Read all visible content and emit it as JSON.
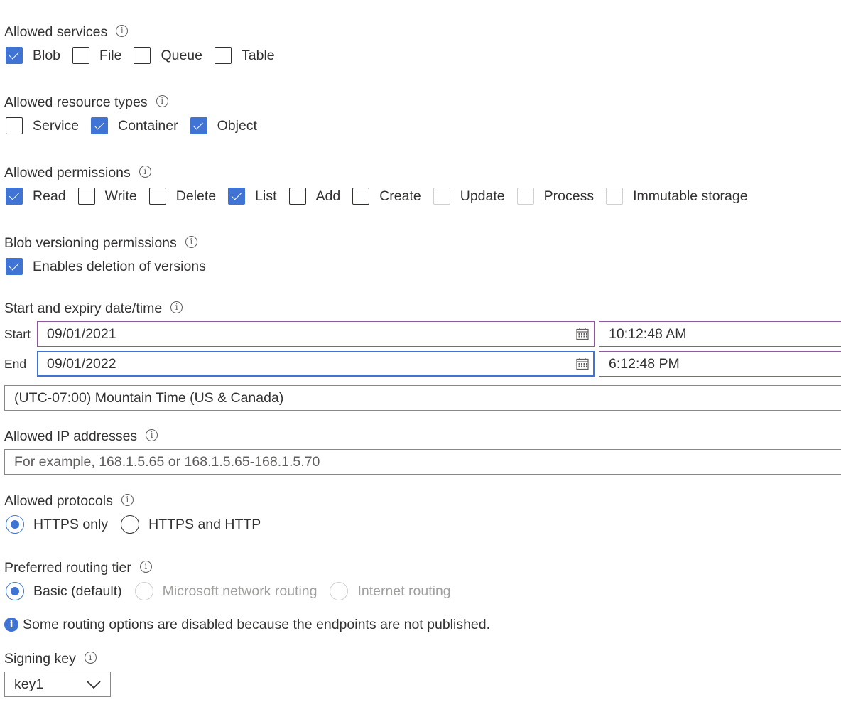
{
  "allowed_services": {
    "label": "Allowed services",
    "items": [
      {
        "label": "Blob",
        "checked": true
      },
      {
        "label": "File",
        "checked": false
      },
      {
        "label": "Queue",
        "checked": false
      },
      {
        "label": "Table",
        "checked": false
      }
    ]
  },
  "allowed_resource_types": {
    "label": "Allowed resource types",
    "items": [
      {
        "label": "Service",
        "checked": false
      },
      {
        "label": "Container",
        "checked": true
      },
      {
        "label": "Object",
        "checked": true
      }
    ]
  },
  "allowed_permissions": {
    "label": "Allowed permissions",
    "items": [
      {
        "label": "Read",
        "checked": true,
        "disabled": false
      },
      {
        "label": "Write",
        "checked": false,
        "disabled": false
      },
      {
        "label": "Delete",
        "checked": false,
        "disabled": false
      },
      {
        "label": "List",
        "checked": true,
        "disabled": false
      },
      {
        "label": "Add",
        "checked": false,
        "disabled": false
      },
      {
        "label": "Create",
        "checked": false,
        "disabled": false
      },
      {
        "label": "Update",
        "checked": false,
        "disabled": true
      },
      {
        "label": "Process",
        "checked": false,
        "disabled": true
      },
      {
        "label": "Immutable storage",
        "checked": false,
        "disabled": true
      }
    ]
  },
  "blob_versioning": {
    "label": "Blob versioning permissions",
    "items": [
      {
        "label": "Enables deletion of versions",
        "checked": true
      }
    ]
  },
  "dates": {
    "label": "Start and expiry date/time",
    "start_label": "Start",
    "start_date": "09/01/2021",
    "start_time": "10:12:48 AM",
    "end_label": "End",
    "end_date": "09/01/2022",
    "end_time": "6:12:48 PM",
    "timezone": "(UTC-07:00) Mountain Time (US & Canada)"
  },
  "ip": {
    "label": "Allowed IP addresses",
    "placeholder": "For example, 168.1.5.65 or 168.1.5.65-168.1.5.70",
    "value": ""
  },
  "protocols": {
    "label": "Allowed protocols",
    "options": [
      {
        "label": "HTTPS only",
        "selected": true,
        "disabled": false
      },
      {
        "label": "HTTPS and HTTP",
        "selected": false,
        "disabled": false
      }
    ]
  },
  "routing": {
    "label": "Preferred routing tier",
    "options": [
      {
        "label": "Basic (default)",
        "selected": true,
        "disabled": false
      },
      {
        "label": "Microsoft network routing",
        "selected": false,
        "disabled": true
      },
      {
        "label": "Internet routing",
        "selected": false,
        "disabled": true
      }
    ],
    "note": "Some routing options are disabled because the endpoints are not published."
  },
  "signing_key": {
    "label": "Signing key",
    "selected": "key1"
  },
  "colors": {
    "accent": "#3f74d4",
    "focus_border": "#3f74d4",
    "date_border": "#8a5a9a",
    "text": "#323130",
    "disabled_text": "#a19f9d"
  }
}
